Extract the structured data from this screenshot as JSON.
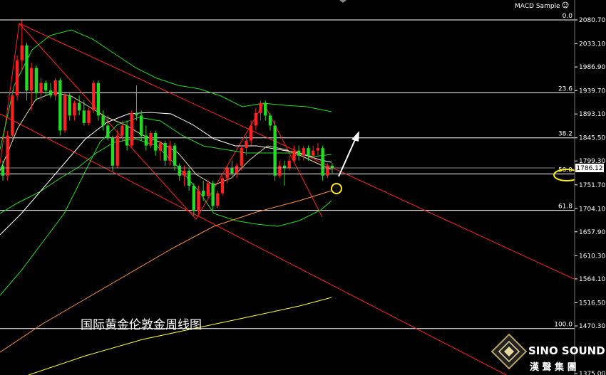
{
  "header": {
    "indicator_label": "MACD Sample"
  },
  "chart_data": {
    "type": "candlestick",
    "title": "国际黄金伦敦金周线图",
    "ylim": [
      1375.0,
      2095.0
    ],
    "y_ticks": [
      "2080.70",
      "2033.10",
      "1986.90",
      "1939.70",
      "1893.10",
      "1845.50",
      "1799.30",
      "1751.70",
      "1704.10",
      "1657.90",
      "1610.30",
      "1564.10",
      "1516.50",
      "1470.30",
      "1375.00"
    ],
    "current_price": "1786.12",
    "colors": {
      "up": "#ff2020",
      "down": "#22dd22",
      "grid": "#ffffff",
      "channel": "#ff2020"
    },
    "fib_levels": [
      {
        "label": "0.0",
        "price": 2080.7
      },
      {
        "label": "23.6",
        "price": 1935.5
      },
      {
        "label": "38.2",
        "price": 1845.5
      },
      {
        "label": "50.0",
        "price": 1773.5
      },
      {
        "label": "61.8",
        "price": 1700.8
      },
      {
        "label": "100.0",
        "price": 1465.0
      }
    ],
    "candles": [
      [
        1790,
        1800,
        1760,
        1770
      ],
      [
        1770,
        1860,
        1760,
        1850
      ],
      [
        1850,
        1940,
        1840,
        1930
      ],
      [
        1930,
        2010,
        1920,
        2000
      ],
      [
        2000,
        2080,
        1980,
        2030
      ],
      [
        2030,
        2035,
        1920,
        1940
      ],
      [
        1940,
        1995,
        1900,
        1985
      ],
      [
        1985,
        1990,
        1920,
        1935
      ],
      [
        1935,
        1965,
        1920,
        1955
      ],
      [
        1955,
        1960,
        1930,
        1940
      ],
      [
        1940,
        1955,
        1925,
        1930
      ],
      [
        1930,
        1965,
        1920,
        1960
      ],
      [
        1960,
        1965,
        1850,
        1860
      ],
      [
        1860,
        1935,
        1855,
        1930
      ],
      [
        1930,
        1935,
        1880,
        1890
      ],
      [
        1890,
        1920,
        1880,
        1915
      ],
      [
        1915,
        1930,
        1890,
        1900
      ],
      [
        1900,
        1920,
        1870,
        1875
      ],
      [
        1875,
        1905,
        1870,
        1900
      ],
      [
        1900,
        1960,
        1895,
        1955
      ],
      [
        1955,
        1960,
        1880,
        1890
      ],
      [
        1890,
        1900,
        1860,
        1870
      ],
      [
        1870,
        1890,
        1840,
        1845
      ],
      [
        1845,
        1850,
        1780,
        1790
      ],
      [
        1790,
        1860,
        1785,
        1850
      ],
      [
        1850,
        1880,
        1840,
        1870
      ],
      [
        1870,
        1880,
        1820,
        1830
      ],
      [
        1830,
        1900,
        1825,
        1895
      ],
      [
        1895,
        1950,
        1880,
        1890
      ],
      [
        1890,
        1900,
        1840,
        1850
      ],
      [
        1850,
        1870,
        1820,
        1830
      ],
      [
        1830,
        1860,
        1825,
        1855
      ],
      [
        1855,
        1860,
        1810,
        1820
      ],
      [
        1820,
        1840,
        1800,
        1835
      ],
      [
        1835,
        1840,
        1790,
        1800
      ],
      [
        1800,
        1840,
        1790,
        1830
      ],
      [
        1830,
        1835,
        1780,
        1790
      ],
      [
        1790,
        1795,
        1760,
        1770
      ],
      [
        1770,
        1790,
        1750,
        1780
      ],
      [
        1780,
        1785,
        1740,
        1750
      ],
      [
        1750,
        1755,
        1690,
        1700
      ],
      [
        1700,
        1750,
        1690,
        1740
      ],
      [
        1740,
        1760,
        1720,
        1730
      ],
      [
        1730,
        1760,
        1725,
        1755
      ],
      [
        1755,
        1760,
        1700,
        1710
      ],
      [
        1710,
        1740,
        1705,
        1735
      ],
      [
        1735,
        1770,
        1730,
        1765
      ],
      [
        1765,
        1790,
        1755,
        1785
      ],
      [
        1785,
        1800,
        1770,
        1775
      ],
      [
        1775,
        1795,
        1765,
        1790
      ],
      [
        1790,
        1830,
        1780,
        1825
      ],
      [
        1825,
        1850,
        1810,
        1840
      ],
      [
        1840,
        1880,
        1830,
        1870
      ],
      [
        1870,
        1905,
        1860,
        1895
      ],
      [
        1895,
        1920,
        1880,
        1915
      ],
      [
        1915,
        1920,
        1880,
        1890
      ],
      [
        1890,
        1895,
        1860,
        1870
      ],
      [
        1870,
        1880,
        1760,
        1770
      ],
      [
        1770,
        1800,
        1765,
        1790
      ],
      [
        1790,
        1800,
        1750,
        1785
      ],
      [
        1785,
        1810,
        1780,
        1800
      ],
      [
        1800,
        1830,
        1795,
        1820
      ],
      [
        1820,
        1830,
        1800,
        1810
      ],
      [
        1810,
        1830,
        1800,
        1825
      ],
      [
        1825,
        1830,
        1800,
        1810
      ],
      [
        1810,
        1830,
        1805,
        1820
      ],
      [
        1820,
        1835,
        1810,
        1825
      ],
      [
        1825,
        1830,
        1760,
        1770
      ],
      [
        1770,
        1795,
        1765,
        1790
      ],
      [
        1790,
        1795,
        1775,
        1785
      ]
    ]
  },
  "logo": {
    "name": "SINO SOUND",
    "subtitle": "漢 聲 集 團"
  }
}
